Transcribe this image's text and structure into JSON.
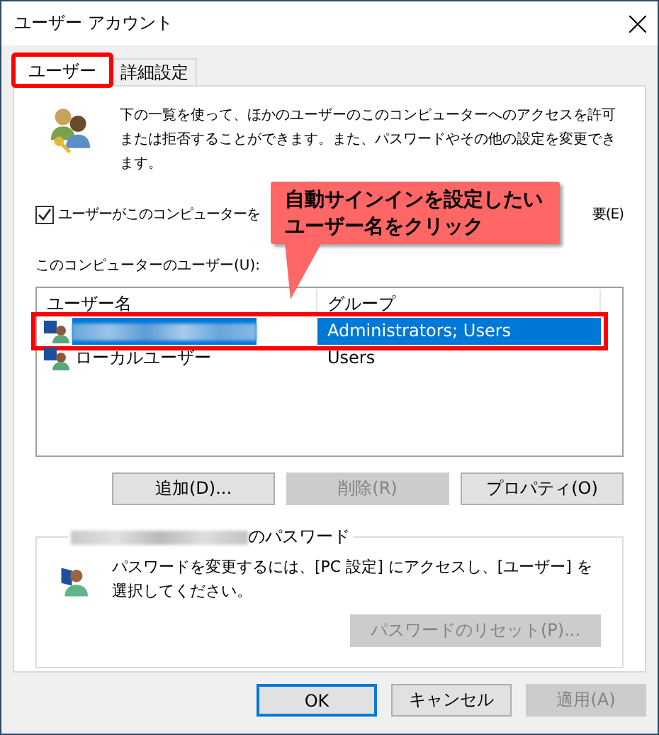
{
  "window": {
    "title": "ユーザー アカウント"
  },
  "tabs": [
    {
      "label": "ユーザー",
      "selected": true,
      "highlighted": true
    },
    {
      "label": "詳細設定",
      "selected": false,
      "highlighted": false
    }
  ],
  "intro": "下の一覧を使って、ほかのユーザーのこのコンピューターへのアクセスを許可または拒否することができます。また、パスワードやその他の設定を変更できます。",
  "checkbox": {
    "label_start": "ユーザーがこのコンピューターを",
    "label_end": "要(E)",
    "checked": true
  },
  "users_label": "このコンピューターのユーザー(U):",
  "list": {
    "columns": [
      "ユーザー名",
      "グループ"
    ],
    "rows": [
      {
        "kind": "blurred",
        "group": "Administrators; Users",
        "selected": true,
        "highlighted": true
      },
      {
        "kind": "text",
        "name": "ローカルユーザー",
        "group": "Users",
        "selected": false,
        "highlighted": false
      }
    ]
  },
  "buttons": [
    {
      "label": "追加(D)...",
      "disabled": false
    },
    {
      "label": "削除(R)",
      "disabled": true
    },
    {
      "label": "プロパティ(O)",
      "disabled": false
    }
  ],
  "password_group": {
    "legend": "のパスワード",
    "text": "パスワードを変更するには、[PC 設定] にアクセスし、[ユーザー] を選択してください。",
    "reset_button": {
      "label": "パスワードのリセット(P)...",
      "disabled": true
    }
  },
  "footer_buttons": [
    {
      "label": "OK",
      "disabled": false,
      "default": true
    },
    {
      "label": "キャンセル",
      "disabled": false,
      "default": false
    },
    {
      "label": "適用(A)",
      "disabled": true,
      "default": false
    }
  ],
  "callout": {
    "lines": [
      "自動サインインを設定したい",
      "ユーザー名をクリック"
    ]
  }
}
